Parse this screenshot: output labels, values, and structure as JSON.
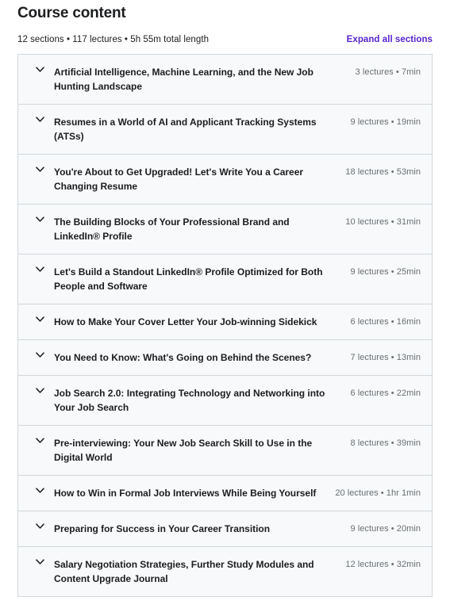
{
  "header": {
    "title": "Course content",
    "summary": "12 sections • 117 lectures • 5h 55m total length",
    "expand_all_label": "Expand all sections",
    "accent_color": "#5624d0"
  },
  "colors": {
    "row_background": "#f7f9fa",
    "border": "#d1d7dc",
    "text_primary": "#1c1d1f",
    "text_secondary": "#6a6f73",
    "link": "#5624d0"
  },
  "sections": [
    {
      "title": "Artificial Intelligence, Machine Learning, and the New Job Hunting Landscape",
      "meta": "3 lectures • 7min",
      "lectures": 3,
      "duration": "7min",
      "icon": "chevron-down-icon"
    },
    {
      "title": "Resumes in a World of AI and Applicant Tracking Systems (ATSs)",
      "meta": "9 lectures • 19min",
      "lectures": 9,
      "duration": "19min",
      "icon": "chevron-down-icon"
    },
    {
      "title": "You're About to Get Upgraded! Let's Write You a Career Changing Resume",
      "meta": "18 lectures • 53min",
      "lectures": 18,
      "duration": "53min",
      "icon": "chevron-down-icon"
    },
    {
      "title": "The Building Blocks of Your Professional Brand and LinkedIn® Profile",
      "meta": "10 lectures • 31min",
      "lectures": 10,
      "duration": "31min",
      "icon": "chevron-down-icon"
    },
    {
      "title": "Let's Build a Standout LinkedIn® Profile Optimized for Both People and Software",
      "meta": "9 lectures • 25min",
      "lectures": 9,
      "duration": "25min",
      "icon": "chevron-down-icon"
    },
    {
      "title": "How to Make Your Cover Letter Your Job-winning Sidekick",
      "meta": "6 lectures • 16min",
      "lectures": 6,
      "duration": "16min",
      "icon": "chevron-down-icon"
    },
    {
      "title": "You Need to Know: What's Going on Behind the Scenes?",
      "meta": "7 lectures • 13min",
      "lectures": 7,
      "duration": "13min",
      "icon": "chevron-down-icon"
    },
    {
      "title": "Job Search 2.0: Integrating Technology and Networking into Your Job Search",
      "meta": "6 lectures • 22min",
      "lectures": 6,
      "duration": "22min",
      "icon": "chevron-down-icon"
    },
    {
      "title": "Pre-interviewing: Your New Job Search Skill to Use in the Digital World",
      "meta": "8 lectures • 39min",
      "lectures": 8,
      "duration": "39min",
      "icon": "chevron-down-icon"
    },
    {
      "title": "How to Win in Formal Job Interviews While Being Yourself",
      "meta": "20 lectures • 1hr 1min",
      "lectures": 20,
      "duration": "1hr 1min",
      "icon": "chevron-down-icon"
    },
    {
      "title": "Preparing for Success in Your Career Transition",
      "meta": "9 lectures • 20min",
      "lectures": 9,
      "duration": "20min",
      "icon": "chevron-down-icon"
    },
    {
      "title": "Salary Negotiation Strategies, Further Study Modules and Content Upgrade Journal",
      "meta": "12 lectures • 32min",
      "lectures": 12,
      "duration": "32min",
      "icon": "chevron-down-icon"
    }
  ]
}
